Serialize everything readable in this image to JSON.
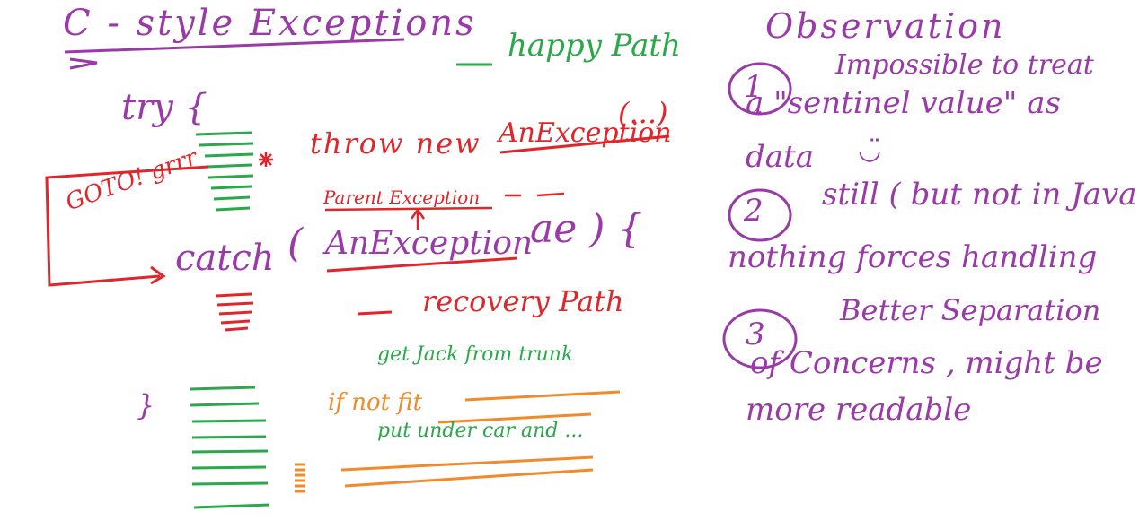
{
  "left": {
    "title": "C - style Exceptions",
    "happy_path": "happy Path",
    "try_open": "try {",
    "throw": "throw new",
    "throw_exception": "AnException",
    "throw_args": "(...)",
    "parent_exception": "Parent Exception",
    "goto_note": "GOTO! grrr",
    "catch_kw": "catch",
    "catch_paren_open": "(",
    "catch_exception": "AnException",
    "catch_end": "ae ) {",
    "recovery_path": "recovery Path",
    "close_brace": "}",
    "get_jack": "get Jack from trunk",
    "if_not": "if not fit",
    "put_order": "put under car and ..."
  },
  "right": {
    "title": "Observation",
    "item1_num": "1",
    "item1_line1": "Impossible to treat",
    "item1_line2": "a \"sentinel value\" as",
    "item1_line3": "data",
    "item1_smiley": "◡̈",
    "item2_num": "2",
    "item2_line1": "still ( but not in Java )",
    "item2_line2": "nothing forces handling",
    "item3_num": "3",
    "item3_line1": "Better Separation",
    "item3_line2": "of Concerns , might be",
    "item3_line3": "more readable"
  },
  "colors": {
    "purple": "#9a3aa8",
    "green": "#2aa84a",
    "red": "#e0262a",
    "orange": "#f08a2a"
  }
}
